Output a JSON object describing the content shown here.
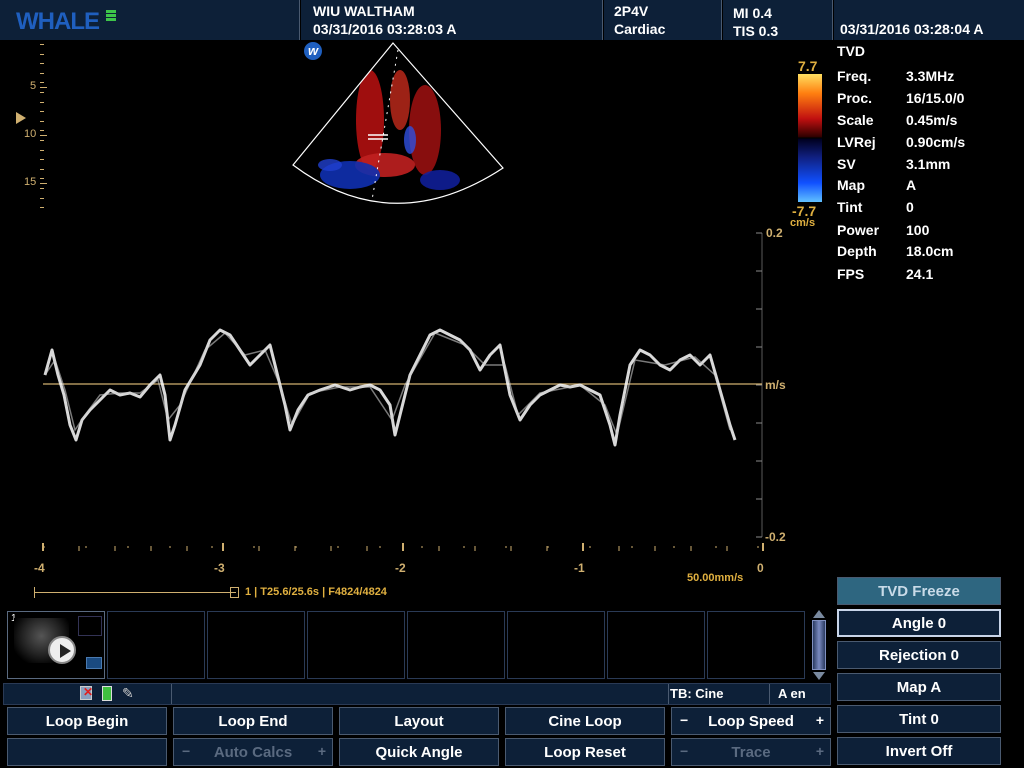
{
  "header": {
    "logo": "WHALE",
    "site": "WIU WALTHAM",
    "datetime": "03/31/2016  03:28:03 A",
    "probe": "2P4V",
    "preset": "Cardiac",
    "mi": "MI  0.4",
    "tis": "TIS 0.3",
    "clock": "03/31/2016  03:28:04 A"
  },
  "colors": {
    "header_bg": "#0d2038",
    "accent": "#e0b040",
    "tvd_panel": "#2e6680",
    "button_border": "#4a5a70"
  },
  "icons": {
    "watermark": "w-badge-icon",
    "focus": "focus-marker-icon",
    "play": "play-icon"
  },
  "depth_scale": {
    "labels": [
      "5",
      "10",
      "15"
    ]
  },
  "colorbar": {
    "max": "7.7",
    "min": "-7.7",
    "unit": "cm/s"
  },
  "params": {
    "title": "TVD",
    "rows": [
      {
        "key": "Freq.",
        "value": "3.3MHz"
      },
      {
        "key": "Proc.",
        "value": "16/15.0/0"
      },
      {
        "key": "Scale",
        "value": "0.45m/s"
      },
      {
        "key": "LVRej",
        "value": "0.90cm/s"
      },
      {
        "key": "SV",
        "value": "3.1mm"
      },
      {
        "key": "Map",
        "value": "A"
      },
      {
        "key": "Tint",
        "value": "0"
      },
      {
        "key": "Power",
        "value": "100"
      },
      {
        "key": "Depth",
        "value": "18.0cm"
      },
      {
        "key": "FPS",
        "value": "24.1"
      }
    ]
  },
  "doppler": {
    "y_top": "0.2",
    "y_bottom": "-0.2",
    "y_unit": "m/s",
    "x_labels": [
      "-4",
      "-3",
      "-2",
      "-1",
      "0"
    ],
    "sweep_speed": "50.00mm/s",
    "cine_info": "1 | T25.6/25.6s | F4824/4824"
  },
  "thumbnail": {
    "index": "1"
  },
  "statusbar": {
    "tb": "TB: Cine",
    "lang": "A  en"
  },
  "buttons": {
    "loop_begin": "Loop Begin",
    "loop_end": "Loop End",
    "layout": "Layout",
    "cine_loop": "Cine Loop",
    "loop_speed": "Loop Speed",
    "auto_calcs": "Auto Calcs",
    "quick_angle": "Quick Angle",
    "loop_reset": "Loop Reset",
    "trace": "Trace",
    "minus": "−",
    "plus": "+"
  },
  "right_panel": {
    "title": "TVD Freeze",
    "angle": "Angle 0",
    "rejection": "Rejection  0",
    "map": "Map A",
    "tint": "Tint 0",
    "invert": "Invert Off"
  }
}
